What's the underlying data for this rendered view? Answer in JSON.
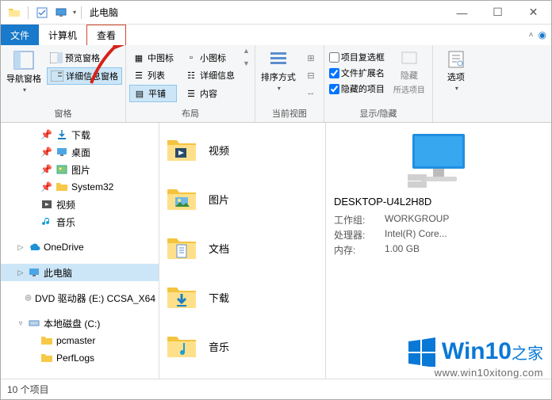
{
  "title": "此电脑",
  "tabs": {
    "file": "文件",
    "computer": "计算机",
    "view": "查看"
  },
  "ribbon": {
    "panes": {
      "label": "窗格",
      "nav": "导航窗格",
      "preview": "预览窗格",
      "details_pane": "详细信息窗格"
    },
    "layout": {
      "label": "布局",
      "medium_icons": "中图标",
      "small_icons": "小图标",
      "list": "列表",
      "details": "详细信息",
      "tiles": "平铺",
      "content": "内容"
    },
    "current_view": {
      "label": "当前视图",
      "sort": "排序方式"
    },
    "show_hide": {
      "label": "显示/隐藏",
      "item_checkboxes": "项目复选框",
      "file_ext": "文件扩展名",
      "hidden_items": "隐藏的项目",
      "hide": "隐藏",
      "hide_sub": "所选项目"
    },
    "options": "选项"
  },
  "tree": {
    "downloads": "下载",
    "desktop": "桌面",
    "pictures": "图片",
    "system32": "System32",
    "videos": "视频",
    "music": "音乐",
    "onedrive": "OneDrive",
    "thispc": "此电脑",
    "dvd": "DVD 驱动器 (E:) CCSA_X64",
    "localdisk": "本地磁盘 (C:)",
    "pcmaster": "pcmaster",
    "perflogs": "PerfLogs"
  },
  "folders": {
    "videos": "视频",
    "pictures": "图片",
    "documents": "文档",
    "downloads": "下载",
    "music": "音乐"
  },
  "details": {
    "name": "DESKTOP-U4L2H8D",
    "workgroup_k": "工作组:",
    "workgroup_v": "WORKGROUP",
    "cpu_k": "处理器:",
    "cpu_v": "Intel(R) Core...",
    "mem_k": "内存:",
    "mem_v": "1.00 GB"
  },
  "status": "10 个项目",
  "watermark": {
    "brand": "Win10",
    "brand_sub": "之家",
    "url": "www.win10xitong.com"
  }
}
